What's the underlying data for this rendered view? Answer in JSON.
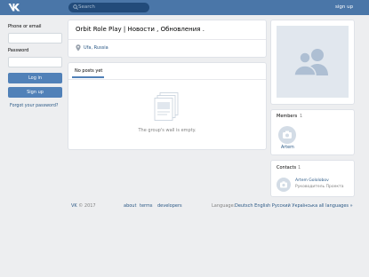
{
  "header": {
    "search_placeholder": "Search",
    "signup_link": "sign up"
  },
  "login": {
    "phone_label": "Phone or email",
    "password_label": "Password",
    "login_button": "Log in",
    "signup_button": "Sign up",
    "forgot_link": "Forgot your password?"
  },
  "group": {
    "title": "Orbit Role Play | Новости , Обновления .",
    "location": "Ufa, Russia"
  },
  "wall": {
    "tab_label": "No posts yet",
    "empty_text": "The group's wall is empty."
  },
  "members": {
    "label": "Members",
    "count": "1",
    "items": [
      {
        "name": "Artem"
      }
    ]
  },
  "contacts": {
    "label": "Contacts",
    "count": "1",
    "items": [
      {
        "name": "Artem Gololobov",
        "role": "Руководитель Проекта"
      }
    ]
  },
  "footer": {
    "vk": "VK",
    "copyright": "© 2017",
    "about": "about",
    "terms": "terms",
    "developers": "developers",
    "language_label": "Language:",
    "languages": "Deutsch English Русский Українська all languages »"
  },
  "colors": {
    "header_bg": "#4a76a8",
    "accent": "#5181b8",
    "link": "#2a5885",
    "page_bg": "#edeef0"
  }
}
